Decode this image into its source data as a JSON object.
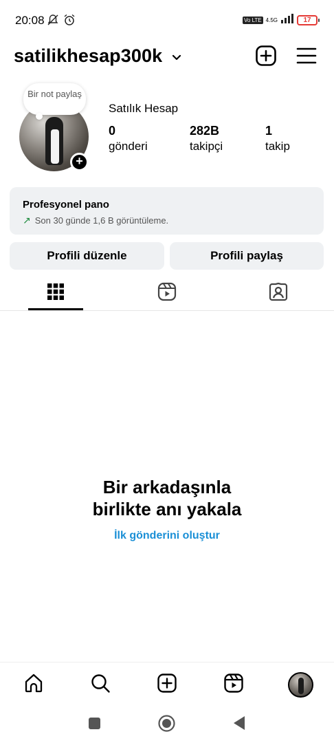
{
  "status_bar": {
    "time": "20:08",
    "volte": "Vo LTE",
    "network": "4.5G",
    "battery": "17"
  },
  "header": {
    "username": "satilikhesap300k"
  },
  "profile": {
    "note": "Bir not paylaş",
    "display_name": "Satılık Hesap",
    "stats": [
      {
        "value": "0",
        "label": "gönderi"
      },
      {
        "value": "282B",
        "label": "takipçi"
      },
      {
        "value": "1",
        "label": "takip"
      }
    ]
  },
  "pro_dashboard": {
    "title": "Profesyonel pano",
    "subtitle": "Son 30 günde 1,6 B görüntüleme."
  },
  "actions": {
    "edit_label": "Profili düzenle",
    "share_label": "Profili paylaş"
  },
  "tabs": [
    {
      "icon": "grid-icon",
      "active": true
    },
    {
      "icon": "reels-icon",
      "active": false
    },
    {
      "icon": "tagged-icon",
      "active": false
    }
  ],
  "empty_state": {
    "title_line1": "Bir arkadaşınla",
    "title_line2": "birlikte anı yakala",
    "cta": "İlk gönderini oluştur"
  },
  "colors": {
    "link": "#1a8fd6",
    "card_bg": "#eff1f3",
    "trend_green": "#1b8a3b",
    "battery_low": "#e53935"
  }
}
